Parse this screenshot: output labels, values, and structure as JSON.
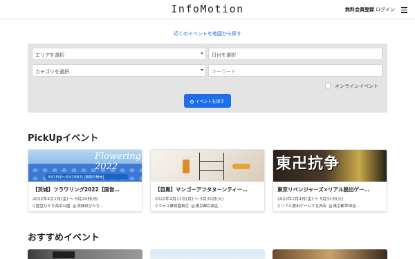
{
  "header": {
    "logo": "InfoMotion",
    "signup": "無料会員登録",
    "login": "ログイン"
  },
  "map_link": "近くのイベントを地図から探す",
  "search": {
    "area_placeholder": "エリアを選択",
    "date_placeholder": "日付を選択",
    "category_placeholder": "カテゴリを選択",
    "keyword_placeholder": "キーワード",
    "online_label": "オンラインイベント",
    "online_checked": false,
    "button_label": "イベントを探す"
  },
  "sections": {
    "pickup": "PickUpイベント",
    "recommended": "おすすめイベント"
  },
  "pickup_cards": [
    {
      "title": "【茨城】フラワリング2022【国営…",
      "date": "2022年4月1日(金) 〜 5月29日(日)",
      "venue": "国営ひたち海浜公園",
      "address": "茨城県ひたち…",
      "thumb_text": "Flowering 2022",
      "thumb_band": "4月1日㊎〜5月29日㊐ [期間中無休]"
    },
    {
      "title": "【目黒】マンゴーアフタヌーンティー…",
      "date": "2022年4月11日(月) 〜 5月31日(火)",
      "venue": "ホテル雅叙園東京",
      "address": "東京都目黒区…"
    },
    {
      "title": "東京リベンジャーズ×リアル脱出ゲー…",
      "date": "2022年2月4日(金) 〜 5月31日(火)",
      "venue": "リアル脱出ゲーム下北沢店",
      "address": "東京都世田谷…",
      "thumb_text": "東卍抗争"
    }
  ],
  "icons": {
    "pin": "map-pin-icon",
    "map": "map-icon",
    "search": "search-icon",
    "menu": "hamburger-menu-icon"
  },
  "colors": {
    "accent": "#1f6feb",
    "link": "#1e6fd9",
    "panel_bg": "#e4e4e4"
  }
}
